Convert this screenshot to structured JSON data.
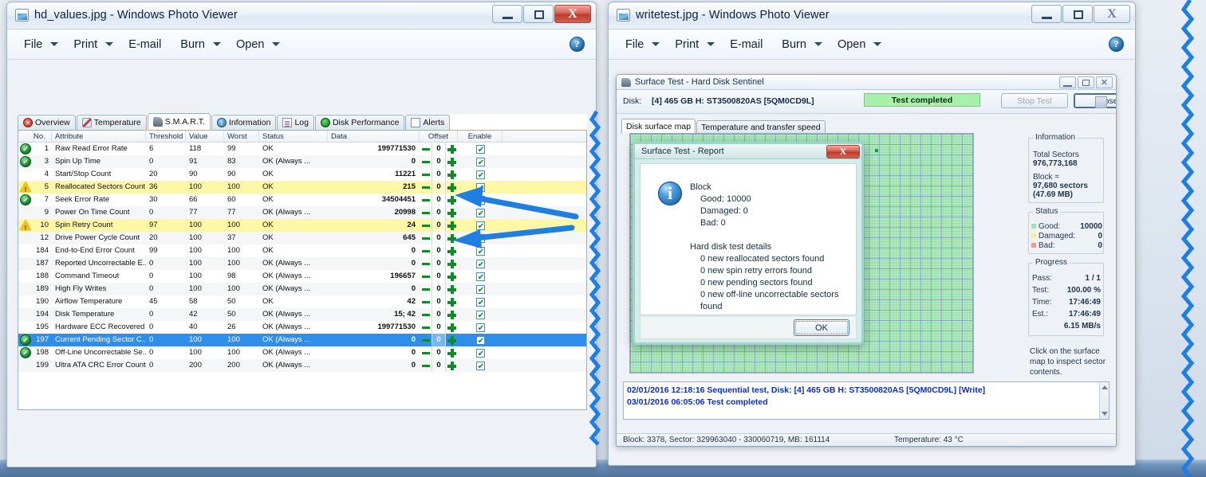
{
  "desktop": {
    "background_color": "#dfe7f0"
  },
  "windows": [
    {
      "id": "left",
      "title": "hd_values.jpg - Windows Photo Viewer",
      "menu": [
        "File",
        "Print",
        "E-mail",
        "Burn",
        "Open"
      ],
      "help_label": "?",
      "buttons": {
        "minimize": "–",
        "maximize": "□",
        "close": "X"
      }
    },
    {
      "id": "right",
      "title": "writetest.jpg - Windows Photo Viewer",
      "menu": [
        "File",
        "Print",
        "E-mail",
        "Burn",
        "Open"
      ],
      "help_label": "?",
      "buttons": {
        "minimize": "–",
        "maximize": "□",
        "close": "X"
      }
    }
  ],
  "hds": {
    "tabs": [
      {
        "label": "Overview",
        "icon": "error-circle-icon",
        "active": false
      },
      {
        "label": "Temperature",
        "icon": "thermometer-icon",
        "active": false
      },
      {
        "label": "S.M.A.R.T.",
        "icon": "smart-chip-icon",
        "active": true
      },
      {
        "label": "Information",
        "icon": "info-circle-icon",
        "active": false
      },
      {
        "label": "Log",
        "icon": "document-icon",
        "active": false
      },
      {
        "label": "Disk Performance",
        "icon": "gauge-icon",
        "active": false
      },
      {
        "label": "Alerts",
        "icon": "pages-icon",
        "active": false
      }
    ],
    "columns": [
      "No.",
      "Attribute",
      "Threshold",
      "Value",
      "Worst",
      "Status",
      "Data",
      "Offset",
      "Enable"
    ],
    "rows": [
      {
        "status_icon": "ok",
        "no": "1",
        "attribute": "Raw Read Error Rate",
        "threshold": "6",
        "value": "118",
        "worst": "99",
        "status": "OK",
        "data": "199771530",
        "offset": "0",
        "enable": true,
        "highlight": "none"
      },
      {
        "status_icon": "ok",
        "no": "3",
        "attribute": "Spin Up Time",
        "threshold": "0",
        "value": "91",
        "worst": "83",
        "status": "OK (Always ...",
        "data": "0",
        "offset": "0",
        "enable": true,
        "highlight": "none"
      },
      {
        "status_icon": "",
        "no": "4",
        "attribute": "Start/Stop Count",
        "threshold": "20",
        "value": "90",
        "worst": "90",
        "status": "OK",
        "data": "11221",
        "offset": "0",
        "enable": true,
        "highlight": "none"
      },
      {
        "status_icon": "warn",
        "no": "5",
        "attribute": "Reallocated Sectors Count",
        "threshold": "36",
        "value": "100",
        "worst": "100",
        "status": "OK",
        "data": "215",
        "offset": "0",
        "enable": true,
        "highlight": "yellow"
      },
      {
        "status_icon": "ok",
        "no": "7",
        "attribute": "Seek Error Rate",
        "threshold": "30",
        "value": "66",
        "worst": "60",
        "status": "OK",
        "data": "34504451",
        "offset": "0",
        "enable": true,
        "highlight": "none"
      },
      {
        "status_icon": "",
        "no": "9",
        "attribute": "Power On Time Count",
        "threshold": "0",
        "value": "77",
        "worst": "77",
        "status": "OK (Always ...",
        "data": "20998",
        "offset": "0",
        "enable": true,
        "highlight": "none"
      },
      {
        "status_icon": "warn",
        "no": "10",
        "attribute": "Spin Retry Count",
        "threshold": "97",
        "value": "100",
        "worst": "100",
        "status": "OK",
        "data": "24",
        "offset": "0",
        "enable": true,
        "highlight": "yellow"
      },
      {
        "status_icon": "",
        "no": "12",
        "attribute": "Drive Power Cycle Count",
        "threshold": "20",
        "value": "100",
        "worst": "37",
        "status": "OK",
        "data": "645",
        "offset": "0",
        "enable": true,
        "highlight": "none"
      },
      {
        "status_icon": "",
        "no": "184",
        "attribute": "End-to-End Error Count",
        "threshold": "99",
        "value": "100",
        "worst": "100",
        "status": "OK",
        "data": "0",
        "offset": "0",
        "enable": true,
        "highlight": "none"
      },
      {
        "status_icon": "",
        "no": "187",
        "attribute": "Reported Uncorrectable E...",
        "threshold": "0",
        "value": "100",
        "worst": "100",
        "status": "OK (Always ...",
        "data": "0",
        "offset": "0",
        "enable": true,
        "highlight": "none"
      },
      {
        "status_icon": "",
        "no": "188",
        "attribute": "Command Timeout",
        "threshold": "0",
        "value": "100",
        "worst": "98",
        "status": "OK (Always ...",
        "data": "196657",
        "offset": "0",
        "enable": true,
        "highlight": "none"
      },
      {
        "status_icon": "",
        "no": "189",
        "attribute": "High Fly Writes",
        "threshold": "0",
        "value": "100",
        "worst": "100",
        "status": "OK (Always ...",
        "data": "0",
        "offset": "0",
        "enable": true,
        "highlight": "none"
      },
      {
        "status_icon": "",
        "no": "190",
        "attribute": "Airflow Temperature",
        "threshold": "45",
        "value": "58",
        "worst": "50",
        "status": "OK",
        "data": "42",
        "offset": "0",
        "enable": true,
        "highlight": "none"
      },
      {
        "status_icon": "",
        "no": "194",
        "attribute": "Disk Temperature",
        "threshold": "0",
        "value": "42",
        "worst": "50",
        "status": "OK (Always ...",
        "data": "15; 42",
        "offset": "0",
        "enable": true,
        "highlight": "none"
      },
      {
        "status_icon": "",
        "no": "195",
        "attribute": "Hardware ECC Recovered",
        "threshold": "0",
        "value": "40",
        "worst": "26",
        "status": "OK (Always ...",
        "data": "199771530",
        "offset": "0",
        "enable": true,
        "highlight": "none"
      },
      {
        "status_icon": "ok",
        "no": "197",
        "attribute": "Current Pending Sector C...",
        "threshold": "0",
        "value": "100",
        "worst": "100",
        "status": "OK (Always ...",
        "data": "0",
        "offset": "0",
        "enable": true,
        "highlight": "selected"
      },
      {
        "status_icon": "ok",
        "no": "198",
        "attribute": "Off-Line Uncorrectable Se...",
        "threshold": "0",
        "value": "100",
        "worst": "100",
        "status": "OK (Always ...",
        "data": "0",
        "offset": "0",
        "enable": true,
        "highlight": "none"
      },
      {
        "status_icon": "",
        "no": "199",
        "attribute": "Ultra ATA CRC Error Count",
        "threshold": "0",
        "value": "200",
        "worst": "200",
        "status": "OK (Always ...",
        "data": "0",
        "offset": "0",
        "enable": true,
        "highlight": "none"
      }
    ]
  },
  "surface_test": {
    "window_title": "Surface Test - Hard Disk Sentinel",
    "disk_label": "Disk:",
    "disk_value": "[4] 465 GB H: ST3500820AS [5QM0CD9L]",
    "status_badge": "Test completed",
    "status_badge_color": "#a9f0ad",
    "stop_button": "Stop Test",
    "close_button": "Close",
    "tabs": [
      {
        "label": "Disk surface map",
        "active": true
      },
      {
        "label": "Temperature and transfer speed",
        "active": false
      }
    ],
    "information": {
      "legend": "Information",
      "total_sectors_label": "Total Sectors",
      "total_sectors_value": "976,773,168",
      "block_label": "Block =",
      "block_value": "97,680 sectors",
      "block_size": "(47.69 MB)"
    },
    "status": {
      "legend": "Status",
      "items": [
        {
          "label": "Good:",
          "value": "10000",
          "color": "#9fe3a8"
        },
        {
          "label": "Damaged:",
          "value": "0",
          "color": "#f2ef9a"
        },
        {
          "label": "Bad:",
          "value": "0",
          "color": "#f09a8c"
        }
      ]
    },
    "progress": {
      "legend": "Progress",
      "items": [
        {
          "label": "Pass:",
          "value": "1 / 1"
        },
        {
          "label": "Test:",
          "value": "100.00 %"
        },
        {
          "label": "Time:",
          "value": "17:46:49"
        },
        {
          "label": "Est.:",
          "value": "17:46:49"
        },
        {
          "label": "",
          "value": "6.15 MB/s"
        }
      ]
    },
    "hint": "Click on the surface map to inspect sector contents.",
    "log_lines": [
      "02/01/2016  12:18:16   Sequential test, Disk: [4] 465 GB H: ST3500820AS [5QM0CD9L] [Write]",
      "03/01/2016  06:05:06   Test completed"
    ],
    "statusbar_left": "Block: 3378, Sector: 329963040 - 330060719, MB: 161114",
    "statusbar_right": "Temperature: 43  °C"
  },
  "report_dialog": {
    "title": "Surface Test - Report",
    "close_label": "X",
    "lines": [
      {
        "text": "Block",
        "indent": false
      },
      {
        "text": "Good: 10000",
        "indent": true
      },
      {
        "text": "Damaged: 0",
        "indent": true
      },
      {
        "text": "Bad: 0",
        "indent": true
      },
      {
        "text": " ",
        "indent": false
      },
      {
        "text": "Hard disk test details",
        "indent": false
      },
      {
        "text": "0 new reallocated sectors found",
        "indent": true
      },
      {
        "text": "0 new spin retry errors found",
        "indent": true
      },
      {
        "text": "0 new pending sectors found",
        "indent": true
      },
      {
        "text": "0 new off-line uncorrectable sectors found",
        "indent": true
      }
    ],
    "ok_label": "OK"
  },
  "annotations": {
    "arrow_color": "#1f7fe0",
    "arrows": 2,
    "zigzag_lines": 2
  }
}
